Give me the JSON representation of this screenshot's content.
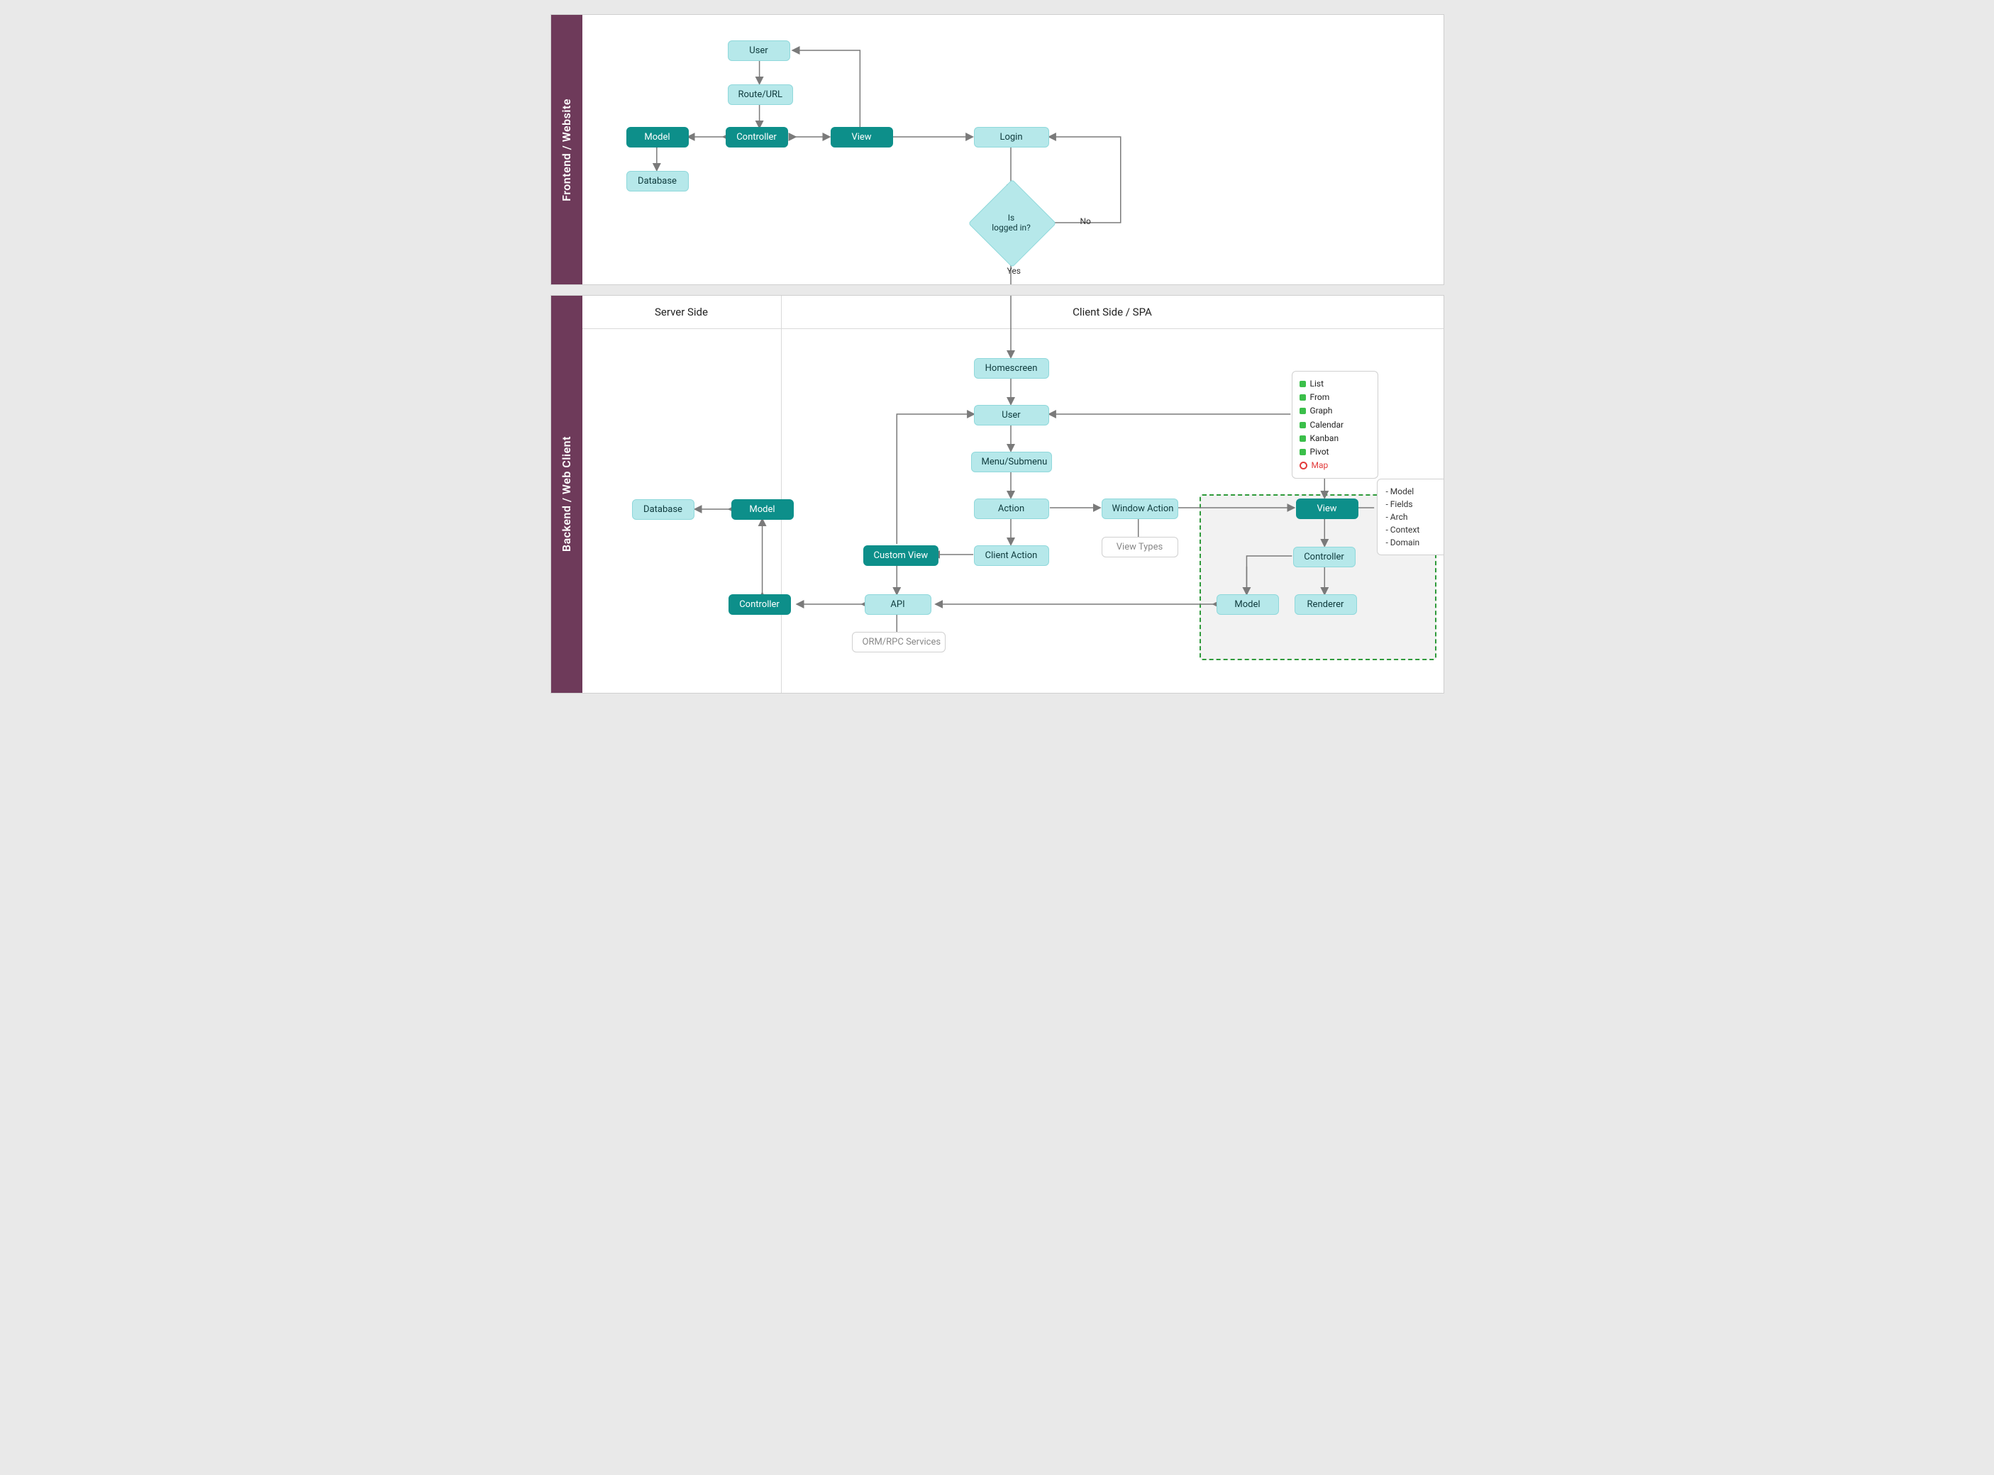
{
  "sections": {
    "frontend": {
      "title": "Frontend / Website"
    },
    "backend": {
      "title": "Backend / Web Client"
    }
  },
  "columns": {
    "server": "Server Side",
    "client": "Client Side / SPA"
  },
  "frontend_nodes": {
    "user": "User",
    "route": "Route/URL",
    "model": "Model",
    "controller": "Controller",
    "view": "View",
    "database": "Database",
    "login": "Login",
    "decision": "Is\nlogged in?",
    "yes": "Yes",
    "no": "No"
  },
  "backend_nodes": {
    "database": "Database",
    "model": "Model",
    "controller": "Controller",
    "api": "API",
    "orm": "ORM/RPC Services",
    "custom_view": "Custom View",
    "homescreen": "Homescreen",
    "user": "User",
    "menu": "Menu/Submenu",
    "action": "Action",
    "client_action": "Client Action",
    "window_action": "Window Action",
    "view_types": "View Types",
    "view": "View",
    "controller2": "Controller",
    "model2": "Model",
    "renderer": "Renderer"
  },
  "view_type_list": {
    "items": [
      {
        "label": "List",
        "kind": "g"
      },
      {
        "label": "From",
        "kind": "g"
      },
      {
        "label": "Graph",
        "kind": "g"
      },
      {
        "label": "Calendar",
        "kind": "g"
      },
      {
        "label": "Kanban",
        "kind": "g"
      },
      {
        "label": "Pivot",
        "kind": "g"
      },
      {
        "label": "Map",
        "kind": "r"
      }
    ]
  },
  "view_info": {
    "items": [
      "- Model",
      "- Fields",
      "- Arch",
      "- Context",
      "- Domain"
    ]
  },
  "colors": {
    "teal": "#0d8f8a",
    "cyan": "#b6e8ea",
    "border": "#cfcfcf",
    "sidebar": "#6e3a5a",
    "dashed": "#2e9a3a",
    "arrow": "#7a7a7a"
  }
}
